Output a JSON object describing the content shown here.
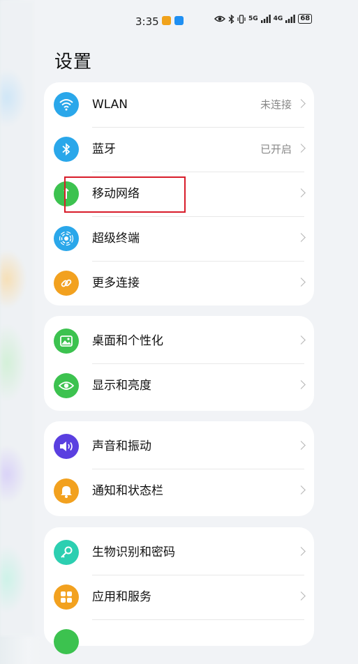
{
  "status_bar": {
    "time": "3:35",
    "badges": [
      {
        "name": "notification-app-icon-1",
        "color": "#f0a21b"
      },
      {
        "name": "notification-app-icon-2",
        "color": "#1f8ff2"
      }
    ],
    "network_1": "5G",
    "network_2": "4G",
    "battery": "68"
  },
  "title": "设置",
  "groups": [
    {
      "items": [
        {
          "id": "wlan",
          "label": "WLAN",
          "value": "未连接",
          "icon": "wifi-icon",
          "color": "#2aa7ea"
        },
        {
          "id": "bluetooth",
          "label": "蓝牙",
          "value": "已开启",
          "icon": "bluetooth-icon",
          "color": "#2aa7ea"
        },
        {
          "id": "mobile-network",
          "label": "移动网络",
          "value": "",
          "icon": "mobile-data-icon",
          "color": "#3cc24f"
        },
        {
          "id": "super-device",
          "label": "超级终端",
          "value": "",
          "icon": "super-device-icon",
          "color": "#2aa7ea"
        },
        {
          "id": "more-connections",
          "label": "更多连接",
          "value": "",
          "icon": "link-icon",
          "color": "#f2a11f"
        }
      ]
    },
    {
      "items": [
        {
          "id": "home-screen",
          "label": "桌面和个性化",
          "value": "",
          "icon": "wallpaper-icon",
          "color": "#3cc24f"
        },
        {
          "id": "display",
          "label": "显示和亮度",
          "value": "",
          "icon": "eye-icon",
          "color": "#3cc24f"
        }
      ]
    },
    {
      "items": [
        {
          "id": "sound",
          "label": "声音和振动",
          "value": "",
          "icon": "speaker-icon",
          "color": "#5a3fe0"
        },
        {
          "id": "notifications",
          "label": "通知和状态栏",
          "value": "",
          "icon": "bell-icon",
          "color": "#f2a11f"
        }
      ]
    },
    {
      "items": [
        {
          "id": "biometrics",
          "label": "生物识别和密码",
          "value": "",
          "icon": "key-icon",
          "color": "#2ccfb1"
        },
        {
          "id": "apps",
          "label": "应用和服务",
          "value": "",
          "icon": "apps-grid-icon",
          "color": "#f2a11f"
        }
      ]
    }
  ],
  "annotation": {
    "highlight_color": "#d81c2a"
  }
}
